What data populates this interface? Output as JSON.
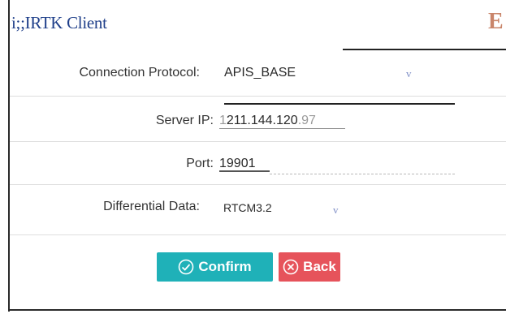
{
  "window": {
    "title": "i;;IRTK Client",
    "corner_mark": "E"
  },
  "form": {
    "protocol": {
      "label": "Connection Protocol:",
      "value": "APIS_BASE",
      "caret": "v"
    },
    "server_ip": {
      "label": "Server IP:",
      "prefix": "1",
      "value_main": "211.144.120",
      "value_dim": ".97"
    },
    "port": {
      "label": "Port:",
      "value": "19901"
    },
    "diff_data": {
      "label": "Differential Data:",
      "value": "RTCM3.2",
      "caret": "v"
    }
  },
  "buttons": {
    "confirm": "Confirm",
    "back": "Back"
  },
  "colors": {
    "confirm": "#1fb1b8",
    "back": "#e6535b",
    "title": "#1f3f8a"
  }
}
